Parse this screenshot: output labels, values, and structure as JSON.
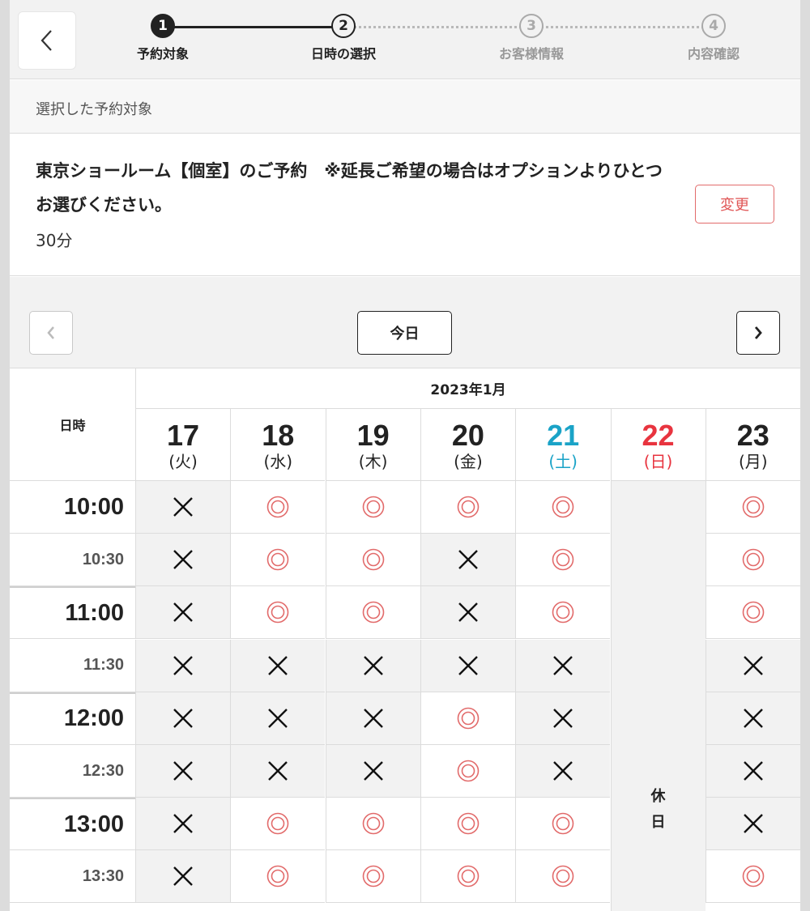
{
  "stepper": {
    "steps": [
      {
        "num": "1",
        "label": "予約対象",
        "state": "done"
      },
      {
        "num": "2",
        "label": "日時の選択",
        "state": "current"
      },
      {
        "num": "3",
        "label": "お客様情報",
        "state": "todo"
      },
      {
        "num": "4",
        "label": "内容確認",
        "state": "todo"
      }
    ]
  },
  "section_title": "選択した予約対象",
  "target": {
    "name": "東京ショールーム【個室】のご予約　※延長ご希望の場合はオプションよりひとつお選びください。",
    "duration": "30分",
    "change_label": "変更"
  },
  "calendar_nav": {
    "today_label": "今日"
  },
  "calendar": {
    "month_label": "2023年1月",
    "corner_label": "日時",
    "days": [
      {
        "num": "17",
        "weekday": "(火)",
        "type": "weekday"
      },
      {
        "num": "18",
        "weekday": "(水)",
        "type": "weekday"
      },
      {
        "num": "19",
        "weekday": "(木)",
        "type": "weekday"
      },
      {
        "num": "20",
        "weekday": "(金)",
        "type": "weekday"
      },
      {
        "num": "21",
        "weekday": "(土)",
        "type": "sat"
      },
      {
        "num": "22",
        "weekday": "(日)",
        "type": "sun"
      },
      {
        "num": "23",
        "weekday": "(月)",
        "type": "weekday"
      }
    ],
    "holiday_text": [
      "休",
      "日"
    ],
    "rows": [
      {
        "time": "10:00",
        "kind": "hour",
        "slots": [
          "x",
          "o",
          "o",
          "o",
          "o",
          "h",
          "o"
        ]
      },
      {
        "time": "10:30",
        "kind": "half",
        "slots": [
          "x",
          "o",
          "o",
          "x",
          "o",
          "h",
          "o"
        ]
      },
      {
        "time": "11:00",
        "kind": "hour",
        "slots": [
          "x",
          "o",
          "o",
          "x",
          "o",
          "h",
          "o"
        ]
      },
      {
        "time": "11:30",
        "kind": "half",
        "slots": [
          "x",
          "x",
          "x",
          "x",
          "x",
          "h",
          "x"
        ]
      },
      {
        "time": "12:00",
        "kind": "hour",
        "slots": [
          "x",
          "x",
          "x",
          "o",
          "x",
          "h",
          "x"
        ]
      },
      {
        "time": "12:30",
        "kind": "half",
        "slots": [
          "x",
          "x",
          "x",
          "o",
          "x",
          "h",
          "x"
        ]
      },
      {
        "time": "13:00",
        "kind": "hour",
        "slots": [
          "x",
          "o",
          "o",
          "o",
          "o",
          "h",
          "x"
        ]
      },
      {
        "time": "13:30",
        "kind": "half",
        "slots": [
          "x",
          "o",
          "o",
          "o",
          "o",
          "h",
          "o"
        ]
      }
    ]
  },
  "colors": {
    "available": "#e26b6b",
    "saturday": "#1aa3c7",
    "sunday": "#e8343f"
  }
}
